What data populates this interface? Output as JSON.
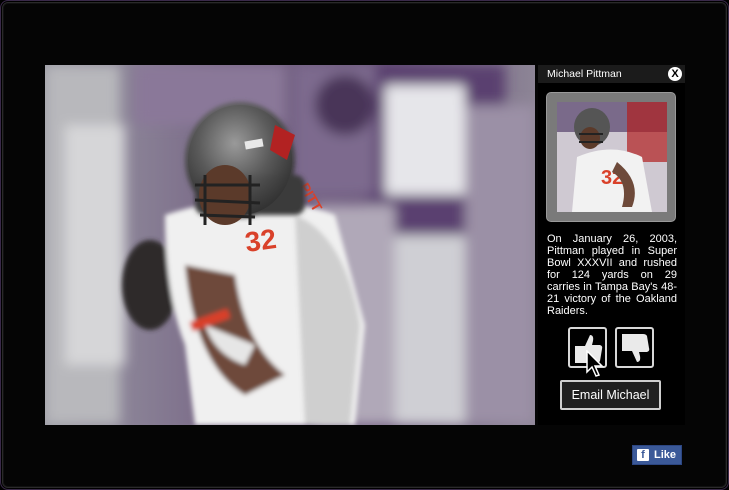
{
  "player": {
    "name": "Michael Pittman",
    "jersey_number": "32",
    "bio": "On January 26, 2003, Pittman played in Super Bowl XXXVII and rushed for 124 yards on 29 carries in Tampa Bay's 48-21 victory of the Oakland Raiders."
  },
  "panel": {
    "close_label": "X",
    "email_label": "Email Michael"
  },
  "facebook": {
    "logo": "f",
    "like_label": "Like"
  },
  "icons": {
    "thumbs_up": "thumbs-up-icon",
    "thumbs_down": "thumbs-down-icon",
    "cursor": "arrow-cursor-icon"
  },
  "colors": {
    "background": "#000000",
    "jersey_white": "#f2f2f2",
    "jersey_number_orange": "#d9412a",
    "helmet": "#5a5a5a",
    "facebook_blue": "#3b5998",
    "crowd_purple": "#6b5a7a"
  }
}
